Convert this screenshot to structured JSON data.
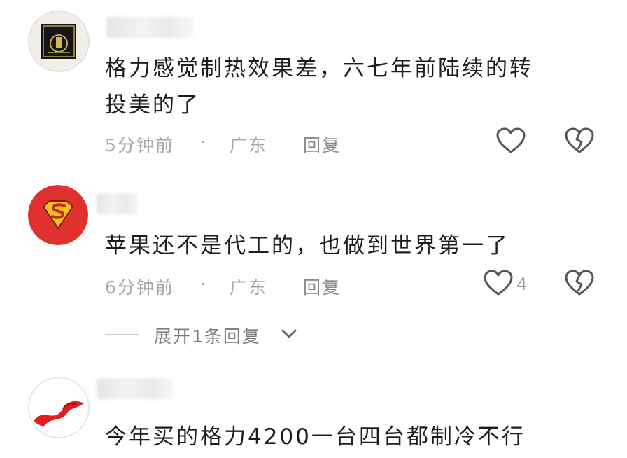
{
  "comments": [
    {
      "text_line1": "格力感觉制热效果差，六七年前陆续的转",
      "text_line2": "投美的了",
      "time": "5分钟前",
      "separator": "·",
      "location": "广东",
      "reply_label": "回复",
      "like_count": "",
      "avatar_icon": "framed-artwork-avatar"
    },
    {
      "text_line1": "苹果还不是代工的，也做到世界第一了",
      "time": "6分钟前",
      "separator": "·",
      "location": "广东",
      "reply_label": "回复",
      "like_count": "4",
      "avatar_icon": "superman-logo-avatar"
    },
    {
      "text_line1": "今年买的格力4200一台四台都制冷不行",
      "avatar_icon": "red-ribbon-avatar"
    }
  ],
  "expand_replies": "展开1条回复",
  "icons": [
    "heart-outline-icon",
    "broken-heart-icon",
    "chevron-down-icon"
  ],
  "colors": {
    "text": "#1c1c1c",
    "meta": "#a8a8a8",
    "icon": "#555555",
    "avatar_red": "#e0312f"
  }
}
